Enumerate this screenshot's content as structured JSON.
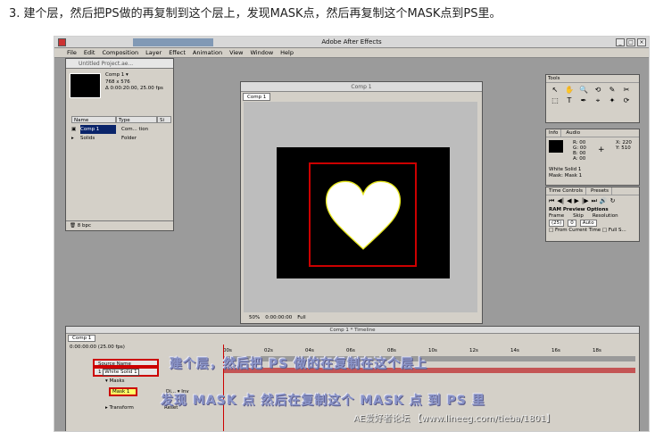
{
  "instruction": "3. 建个层，然后把PS做的再复制到这个层上，发现MASK点，然后再复制这个MASK点到PS里。",
  "app": {
    "title": "Adobe After Effects"
  },
  "menu": [
    "File",
    "Edit",
    "Composition",
    "Layer",
    "Effect",
    "Animation",
    "View",
    "Window",
    "Help"
  ],
  "project": {
    "title": "Untitled Project.ae...",
    "comp_name": "Comp 1 ▾",
    "size": "768 x 576",
    "duration": "Δ 0:00:20:00, 25.00 fps",
    "columns": [
      "Name",
      "Type",
      "Si"
    ],
    "items": [
      {
        "name": "Comp 1",
        "type": "Com... tion"
      },
      {
        "name": "Solids",
        "type": "Folder"
      }
    ],
    "depth": "8 bpc"
  },
  "comp_window": {
    "title": "Comp 1",
    "tab": "Comp 1",
    "zoom": "50%",
    "timecode": "0:00:00:00",
    "resolution": "Full"
  },
  "tools_panel": {
    "title": "Tools",
    "icons": [
      "↖",
      "✋",
      "🔍",
      "⟲",
      "✎",
      "✂",
      "⬚",
      "T",
      "✒",
      "⌖",
      "✦",
      "⟳"
    ]
  },
  "info_panel": {
    "tabs": [
      "Info",
      "Audio"
    ],
    "r": "00",
    "g": "00",
    "b": "00",
    "a": "00",
    "x": "220",
    "y": "510",
    "layer": "White Solid 1",
    "mask": "Mask: Mask 1"
  },
  "time_controls": {
    "tabs": [
      "Time Controls",
      "Presets"
    ],
    "buttons": [
      "⏮",
      "◀|",
      "◀",
      "▶",
      "|▶",
      "⏭",
      "🔊",
      "↻"
    ],
    "ram_header": "RAM Preview Options",
    "labels": [
      "Frame",
      "Skip",
      "Resolution"
    ],
    "values": [
      "(25)",
      "0",
      "Auto"
    ],
    "checkboxes": "□ From Current Time  □ Full S..."
  },
  "timeline": {
    "title": "Comp 1 * Timeline",
    "tab": "Comp 1",
    "current_time": "0:00:00:00  (25.00 fps)",
    "ruler": [
      "00s",
      "02s",
      "04s",
      "06s",
      "08s",
      "10s",
      "12s",
      "14s",
      "16s",
      "18s"
    ],
    "source_name_header": "Source Name",
    "layer_number": "1",
    "layer_name": "White Solid 1",
    "mask_label": "Masks",
    "mask_name": "Mask 1",
    "transform_label": "Transform",
    "reset_label": "Reset",
    "mode_label": "Di...   ▾  Inv"
  },
  "overlay": {
    "line1": "建个层，然后把 PS 做的在复制在这个层上",
    "line2": "发现 MASK 点    然后在复制这个 MASK 点 到 PS 里"
  },
  "watermark": "AE爱好者论坛 【www.lineeg.com/tieba/1801】"
}
